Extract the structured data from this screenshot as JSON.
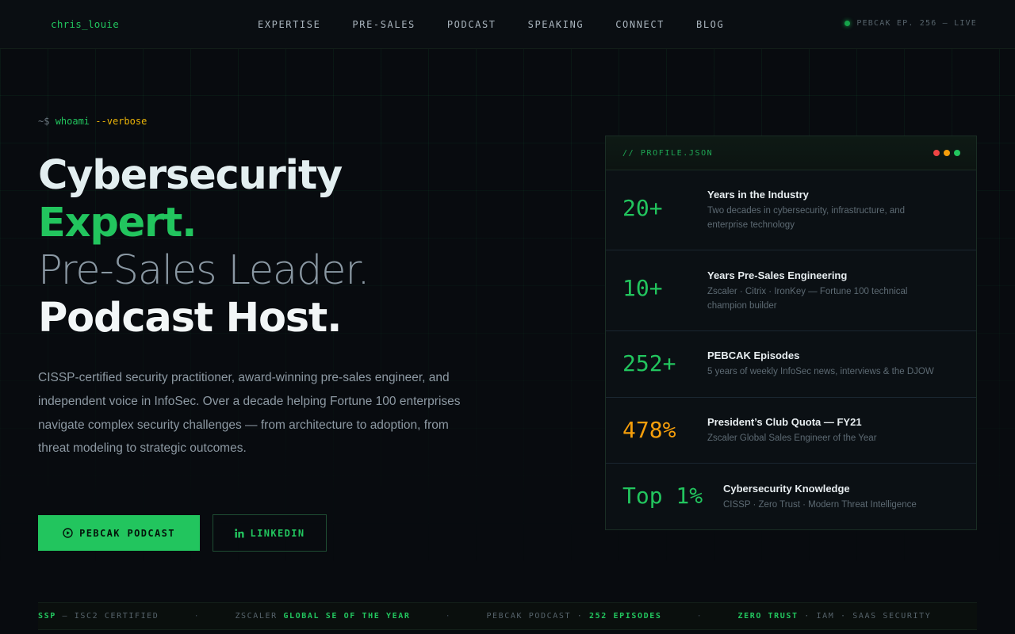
{
  "header": {
    "brand": "chris_louie",
    "nav": [
      "EXPERTISE",
      "PRE-SALES",
      "PODCAST",
      "SPEAKING",
      "CONNECT",
      "BLOG"
    ],
    "live_status": "PEBCAK EP. 256 — LIVE"
  },
  "hero": {
    "prompt": {
      "sign": "~$",
      "command": "whoami",
      "flag": "--verbose"
    },
    "headline": [
      "Cybersecurity",
      "Expert.",
      "Pre-Sales Leader.",
      "Podcast Host."
    ],
    "intro": "CISSP-certified security practitioner, award-winning pre-sales engineer, and independent voice in InfoSec. Over a decade helping Fortune 100 enterprises navigate complex security challenges — from architecture to adoption, from threat modeling to strategic outcomes.",
    "primary_button": "PEBCAK PODCAST",
    "secondary_button": "LINKEDIN"
  },
  "profile": {
    "title": "// PROFILE.JSON",
    "window_dots": [
      "#ef4444",
      "#f59e0b",
      "#22c55e"
    ],
    "stats": [
      {
        "value": "20+",
        "label": "Years in the Industry",
        "desc": "Two decades in cybersecurity, infrastructure, and enterprise technology"
      },
      {
        "value": "10+",
        "label": "Years Pre-Sales Engineering",
        "desc": "Zscaler · Citrix · IronKey — Fortune 100 technical champion builder"
      },
      {
        "value": "252+",
        "label": "PEBCAK Episodes",
        "desc": "5 years of weekly InfoSec news, interviews & the DJOW"
      },
      {
        "value": "478%",
        "label": "President’s Club Quota — FY21",
        "desc": "Zscaler Global Sales Engineer of the Year"
      },
      {
        "value": "Top 1%",
        "label": "Cybersecurity Knowledge",
        "desc": "CISSP · Zero Trust · Modern Threat Intelligence"
      }
    ]
  },
  "ticker": [
    {
      "dim": "SSP — ISC2 CERTIFIED",
      "hi": ""
    },
    {
      "dim": "ZSCALER",
      "hi": "GLOBAL SE OF THE YEAR"
    },
    {
      "dim": "PEBCAK PODCAST ·",
      "hi": "252 EPISODES"
    },
    {
      "dim": "· IAM · SAAS SECURITY",
      "hi": "ZERO TRUST",
      "hi_first": true
    }
  ],
  "colors": {
    "accent": "#22c55e",
    "amber": "#f59e0b",
    "background": "#080b0f"
  }
}
